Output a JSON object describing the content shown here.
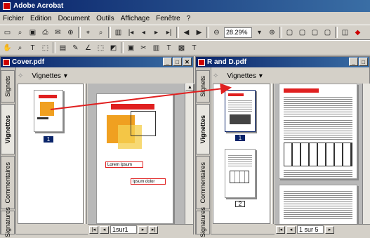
{
  "app": {
    "title": "Adobe Acrobat"
  },
  "menu": [
    "Fichier",
    "Edition",
    "Document",
    "Outils",
    "Affichage",
    "Fenêtre",
    "?"
  ],
  "toolbar": {
    "zoom": "28.29%"
  },
  "left_window": {
    "title": "Cover.pdf",
    "panel_label": "Vignettes",
    "tabs": [
      "Signets",
      "Vignettes",
      "Commentaires",
      "Signatures"
    ],
    "thumb_page": "1",
    "page_field": "1sur1",
    "fields_label1": "Lorem Ipsum",
    "fields_label2": "Ipsum dolor"
  },
  "right_window": {
    "title": "R and D.pdf",
    "panel_label": "Vignettes",
    "tabs": [
      "Signets",
      "Vignettes",
      "Commentaires",
      "Signatures"
    ],
    "thumb_pages": [
      "1",
      "2"
    ],
    "page_field": "1 sur 5"
  },
  "colors": {
    "accent": "#0a246a",
    "arrow": "#e02020",
    "brand_orange": "#f0a020"
  }
}
